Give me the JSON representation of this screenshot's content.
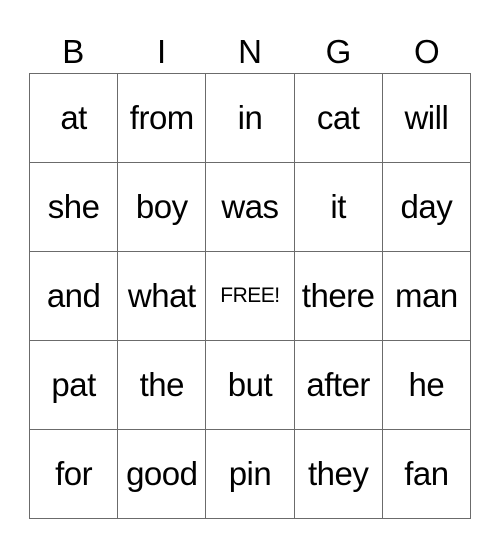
{
  "header": [
    "B",
    "I",
    "N",
    "G",
    "O"
  ],
  "rows": [
    [
      "at",
      "from",
      "in",
      "cat",
      "will"
    ],
    [
      "she",
      "boy",
      "was",
      "it",
      "day"
    ],
    [
      "and",
      "what",
      "FREE!",
      "there",
      "man"
    ],
    [
      "pat",
      "the",
      "but",
      "after",
      "he"
    ],
    [
      "for",
      "good",
      "pin",
      "they",
      "fan"
    ]
  ]
}
